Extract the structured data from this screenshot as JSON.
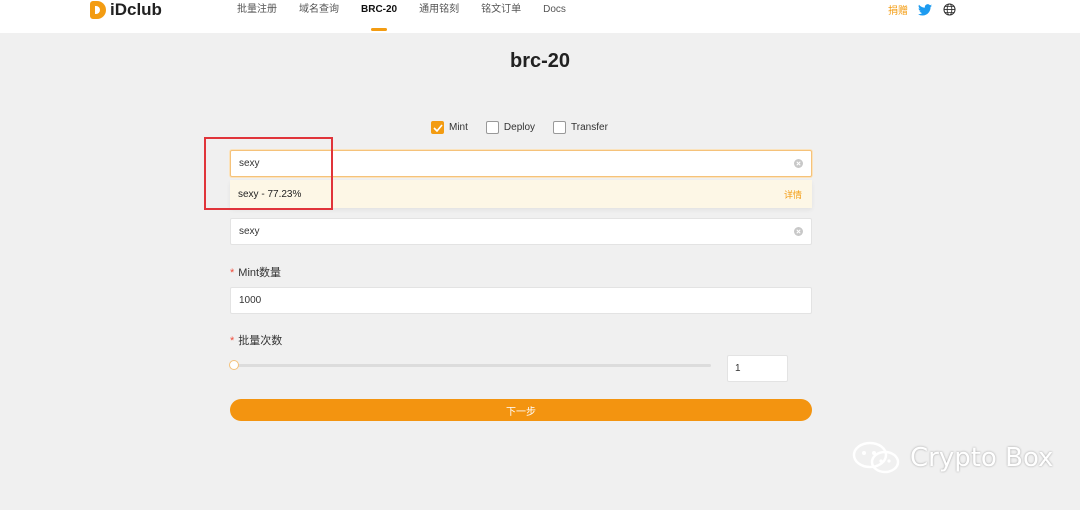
{
  "header": {
    "logo_text": "iDclub",
    "nav": [
      "批量注册",
      "域名查询",
      "BRC-20",
      "通用铭刻",
      "铭文订单",
      "Docs"
    ],
    "active_nav": "BRC-20",
    "donate": "捐赠"
  },
  "page": {
    "title": "brc-20"
  },
  "tabs": [
    {
      "label": "Mint",
      "checked": true
    },
    {
      "label": "Deploy",
      "checked": false
    },
    {
      "label": "Transfer",
      "checked": false
    }
  ],
  "search": {
    "value": "sexy"
  },
  "suggestion": {
    "text": "sexy - 77.23%",
    "detail": "详情"
  },
  "ticker": {
    "value": "sexy"
  },
  "mint_amount": {
    "label": "Mint数量",
    "value": "1000"
  },
  "batch": {
    "label": "批量次数",
    "value": "1",
    "slider_level": 0
  },
  "next_button": {
    "label": "下一步"
  },
  "watermark": {
    "text": "Crypto Box"
  },
  "colors": {
    "accent": "#f39410",
    "highlight": "#e0343a",
    "required": "#f04d3c"
  }
}
